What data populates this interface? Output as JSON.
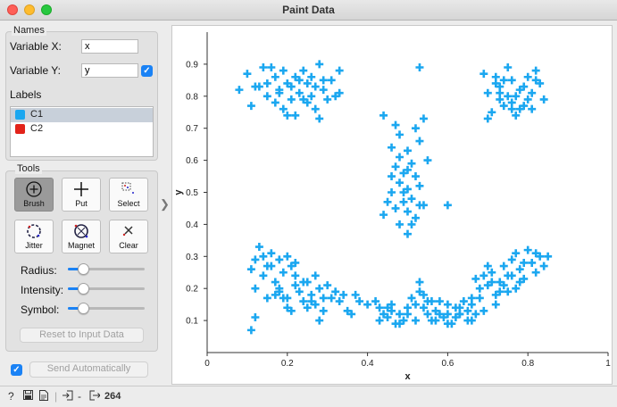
{
  "window": {
    "title": "Paint Data"
  },
  "names": {
    "section_title": "Names",
    "variable_x_label": "Variable X:",
    "variable_x_value": "x",
    "variable_y_label": "Variable Y:",
    "variable_y_value": "y",
    "variable_y_checked": true
  },
  "labels": {
    "section_title": "Labels",
    "items": [
      {
        "label": "C1",
        "color": "#1ba7f0",
        "selected": true
      },
      {
        "label": "C2",
        "color": "#e2231a",
        "selected": false
      }
    ]
  },
  "tools": {
    "section_title": "Tools",
    "buttons": [
      {
        "label": "Brush",
        "icon": "brush-icon",
        "active": true
      },
      {
        "label": "Put",
        "icon": "put-icon",
        "active": false
      },
      {
        "label": "Select",
        "icon": "select-icon",
        "active": false
      },
      {
        "label": "Jitter",
        "icon": "jitter-icon",
        "active": false
      },
      {
        "label": "Magnet",
        "icon": "magnet-icon",
        "active": false
      },
      {
        "label": "Clear",
        "icon": "clear-icon",
        "active": false
      }
    ],
    "sliders": [
      {
        "label": "Radius:",
        "value": 0.2
      },
      {
        "label": "Intensity:",
        "value": 0.2
      },
      {
        "label": "Symbol:",
        "value": 0.2
      }
    ],
    "reset_label": "Reset to Input Data"
  },
  "footer": {
    "send_auto_checked": true,
    "send_auto_label": "Send Automatically"
  },
  "statusbar": {
    "input_value": "-",
    "output_count": "264"
  },
  "colors": {
    "accent": "#1a82f5",
    "point": "#1ba7f0"
  },
  "chart_data": {
    "type": "scatter",
    "xlabel": "x",
    "ylabel": "y",
    "xlim": [
      0,
      1
    ],
    "ylim": [
      0,
      1
    ],
    "xticks": [
      "0",
      "0.2",
      "0.4",
      "0.6",
      "0.8",
      "1"
    ],
    "yticks": [
      "0.1",
      "0.2",
      "0.3",
      "0.4",
      "0.5",
      "0.6",
      "0.7",
      "0.8",
      "0.9"
    ],
    "grid": false,
    "marker": "+",
    "series": [
      {
        "name": "C1",
        "points": [
          [
            0.1,
            0.87
          ],
          [
            0.08,
            0.82
          ],
          [
            0.11,
            0.77
          ],
          [
            0.14,
            0.89
          ],
          [
            0.16,
            0.89
          ],
          [
            0.13,
            0.83
          ],
          [
            0.15,
            0.8
          ],
          [
            0.17,
            0.86
          ],
          [
            0.18,
            0.82
          ],
          [
            0.19,
            0.88
          ],
          [
            0.2,
            0.84
          ],
          [
            0.21,
            0.79
          ],
          [
            0.22,
            0.86
          ],
          [
            0.23,
            0.81
          ],
          [
            0.24,
            0.88
          ],
          [
            0.25,
            0.84
          ],
          [
            0.26,
            0.8
          ],
          [
            0.27,
            0.76
          ],
          [
            0.28,
            0.9
          ],
          [
            0.29,
            0.85
          ],
          [
            0.3,
            0.79
          ],
          [
            0.31,
            0.85
          ],
          [
            0.33,
            0.81
          ],
          [
            0.33,
            0.88
          ],
          [
            0.2,
            0.74
          ],
          [
            0.22,
            0.74
          ],
          [
            0.28,
            0.73
          ],
          [
            0.18,
            0.81
          ],
          [
            0.19,
            0.76
          ],
          [
            0.21,
            0.83
          ],
          [
            0.24,
            0.79
          ],
          [
            0.26,
            0.86
          ],
          [
            0.15,
            0.84
          ],
          [
            0.17,
            0.78
          ],
          [
            0.23,
            0.85
          ],
          [
            0.25,
            0.78
          ],
          [
            0.27,
            0.83
          ],
          [
            0.29,
            0.82
          ],
          [
            0.32,
            0.8
          ],
          [
            0.12,
            0.83
          ],
          [
            0.53,
            0.89
          ],
          [
            0.44,
            0.74
          ],
          [
            0.47,
            0.71
          ],
          [
            0.48,
            0.68
          ],
          [
            0.52,
            0.7
          ],
          [
            0.54,
            0.73
          ],
          [
            0.46,
            0.64
          ],
          [
            0.5,
            0.63
          ],
          [
            0.53,
            0.66
          ],
          [
            0.55,
            0.6
          ],
          [
            0.47,
            0.58
          ],
          [
            0.49,
            0.56
          ],
          [
            0.51,
            0.59
          ],
          [
            0.48,
            0.53
          ],
          [
            0.5,
            0.51
          ],
          [
            0.52,
            0.55
          ],
          [
            0.46,
            0.5
          ],
          [
            0.49,
            0.47
          ],
          [
            0.51,
            0.48
          ],
          [
            0.53,
            0.46
          ],
          [
            0.45,
            0.47
          ],
          [
            0.47,
            0.45
          ],
          [
            0.5,
            0.44
          ],
          [
            0.52,
            0.42
          ],
          [
            0.54,
            0.46
          ],
          [
            0.44,
            0.43
          ],
          [
            0.48,
            0.4
          ],
          [
            0.51,
            0.4
          ],
          [
            0.5,
            0.37
          ],
          [
            0.6,
            0.46
          ],
          [
            0.46,
            0.55
          ],
          [
            0.5,
            0.57
          ],
          [
            0.49,
            0.5
          ],
          [
            0.53,
            0.52
          ],
          [
            0.48,
            0.61
          ],
          [
            0.69,
            0.87
          ],
          [
            0.7,
            0.81
          ],
          [
            0.72,
            0.84
          ],
          [
            0.73,
            0.79
          ],
          [
            0.74,
            0.77
          ],
          [
            0.75,
            0.89
          ],
          [
            0.76,
            0.85
          ],
          [
            0.77,
            0.8
          ],
          [
            0.78,
            0.76
          ],
          [
            0.79,
            0.83
          ],
          [
            0.8,
            0.86
          ],
          [
            0.81,
            0.81
          ],
          [
            0.82,
            0.88
          ],
          [
            0.83,
            0.84
          ],
          [
            0.84,
            0.79
          ],
          [
            0.71,
            0.75
          ],
          [
            0.73,
            0.83
          ],
          [
            0.76,
            0.78
          ],
          [
            0.79,
            0.77
          ],
          [
            0.82,
            0.85
          ],
          [
            0.77,
            0.74
          ],
          [
            0.78,
            0.82
          ],
          [
            0.74,
            0.85
          ],
          [
            0.75,
            0.8
          ],
          [
            0.7,
            0.73
          ],
          [
            0.8,
            0.79
          ],
          [
            0.72,
            0.86
          ],
          [
            0.81,
            0.76
          ],
          [
            0.76,
            0.76
          ],
          [
            0.73,
            0.81
          ],
          [
            0.13,
            0.33
          ],
          [
            0.12,
            0.29
          ],
          [
            0.11,
            0.26
          ],
          [
            0.14,
            0.24
          ],
          [
            0.15,
            0.27
          ],
          [
            0.16,
            0.31
          ],
          [
            0.17,
            0.22
          ],
          [
            0.18,
            0.29
          ],
          [
            0.19,
            0.25
          ],
          [
            0.2,
            0.3
          ],
          [
            0.21,
            0.27
          ],
          [
            0.22,
            0.21
          ],
          [
            0.23,
            0.19
          ],
          [
            0.24,
            0.16
          ],
          [
            0.25,
            0.22
          ],
          [
            0.26,
            0.18
          ],
          [
            0.27,
            0.15
          ],
          [
            0.28,
            0.2
          ],
          [
            0.29,
            0.17
          ],
          [
            0.3,
            0.21
          ],
          [
            0.12,
            0.2
          ],
          [
            0.15,
            0.17
          ],
          [
            0.18,
            0.19
          ],
          [
            0.19,
            0.17
          ],
          [
            0.2,
            0.14
          ],
          [
            0.21,
            0.13
          ],
          [
            0.22,
            0.24
          ],
          [
            0.24,
            0.22
          ],
          [
            0.26,
            0.16
          ],
          [
            0.27,
            0.24
          ],
          [
            0.29,
            0.13
          ],
          [
            0.31,
            0.17
          ],
          [
            0.32,
            0.19
          ],
          [
            0.33,
            0.16
          ],
          [
            0.34,
            0.18
          ],
          [
            0.35,
            0.13
          ],
          [
            0.36,
            0.12
          ],
          [
            0.37,
            0.18
          ],
          [
            0.38,
            0.16
          ],
          [
            0.4,
            0.15
          ],
          [
            0.12,
            0.11
          ],
          [
            0.11,
            0.07
          ],
          [
            0.2,
            0.17
          ],
          [
            0.17,
            0.18
          ],
          [
            0.25,
            0.14
          ],
          [
            0.28,
            0.1
          ],
          [
            0.16,
            0.27
          ],
          [
            0.14,
            0.3
          ],
          [
            0.18,
            0.2
          ],
          [
            0.22,
            0.28
          ],
          [
            0.42,
            0.16
          ],
          [
            0.43,
            0.1
          ],
          [
            0.44,
            0.12
          ],
          [
            0.45,
            0.14
          ],
          [
            0.46,
            0.13
          ],
          [
            0.47,
            0.09
          ],
          [
            0.48,
            0.12
          ],
          [
            0.49,
            0.1
          ],
          [
            0.5,
            0.12
          ],
          [
            0.51,
            0.17
          ],
          [
            0.52,
            0.1
          ],
          [
            0.53,
            0.22
          ],
          [
            0.54,
            0.14
          ],
          [
            0.55,
            0.12
          ],
          [
            0.56,
            0.1
          ],
          [
            0.57,
            0.13
          ],
          [
            0.58,
            0.16
          ],
          [
            0.59,
            0.11
          ],
          [
            0.6,
            0.15
          ],
          [
            0.61,
            0.09
          ],
          [
            0.62,
            0.11
          ],
          [
            0.63,
            0.14
          ],
          [
            0.64,
            0.16
          ],
          [
            0.65,
            0.1
          ],
          [
            0.66,
            0.15
          ],
          [
            0.67,
            0.12
          ],
          [
            0.68,
            0.17
          ],
          [
            0.69,
            0.13
          ],
          [
            0.46,
            0.15
          ],
          [
            0.52,
            0.15
          ],
          [
            0.55,
            0.16
          ],
          [
            0.58,
            0.12
          ],
          [
            0.6,
            0.09
          ],
          [
            0.63,
            0.12
          ],
          [
            0.66,
            0.1
          ],
          [
            0.48,
            0.09
          ],
          [
            0.5,
            0.14
          ],
          [
            0.57,
            0.1
          ],
          [
            0.7,
            0.21
          ],
          [
            0.71,
            0.25
          ],
          [
            0.72,
            0.18
          ],
          [
            0.73,
            0.22
          ],
          [
            0.74,
            0.27
          ],
          [
            0.75,
            0.24
          ],
          [
            0.76,
            0.29
          ],
          [
            0.77,
            0.2
          ],
          [
            0.78,
            0.26
          ],
          [
            0.79,
            0.23
          ],
          [
            0.8,
            0.32
          ],
          [
            0.81,
            0.28
          ],
          [
            0.82,
            0.25
          ],
          [
            0.83,
            0.3
          ],
          [
            0.84,
            0.27
          ],
          [
            0.85,
            0.3
          ],
          [
            0.68,
            0.2
          ],
          [
            0.69,
            0.24
          ],
          [
            0.72,
            0.15
          ],
          [
            0.75,
            0.19
          ],
          [
            0.77,
            0.31
          ],
          [
            0.78,
            0.22
          ],
          [
            0.7,
            0.27
          ],
          [
            0.73,
            0.19
          ],
          [
            0.76,
            0.24
          ],
          [
            0.79,
            0.28
          ],
          [
            0.71,
            0.22
          ],
          [
            0.74,
            0.21
          ],
          [
            0.82,
            0.31
          ],
          [
            0.67,
            0.23
          ],
          [
            0.63,
            0.12
          ],
          [
            0.65,
            0.13
          ],
          [
            0.6,
            0.12
          ],
          [
            0.62,
            0.14
          ],
          [
            0.66,
            0.17
          ],
          [
            0.54,
            0.18
          ],
          [
            0.53,
            0.19
          ],
          [
            0.56,
            0.16
          ],
          [
            0.43,
            0.14
          ],
          [
            0.45,
            0.11
          ]
        ]
      }
    ]
  }
}
